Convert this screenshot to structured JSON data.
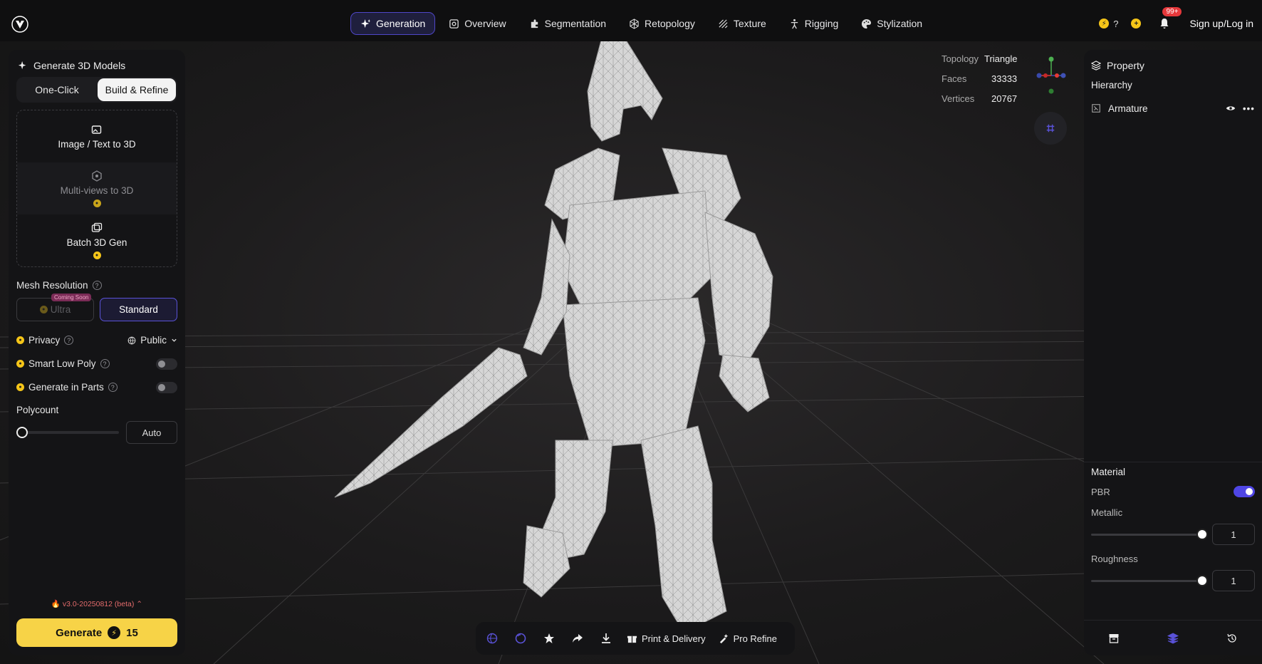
{
  "nav": {
    "items": [
      {
        "label": "Generation",
        "icon": "sparkle-icon",
        "active": true
      },
      {
        "label": "Overview",
        "icon": "overview-icon"
      },
      {
        "label": "Segmentation",
        "icon": "puzzle-icon"
      },
      {
        "label": "Retopology",
        "icon": "mesh-icon"
      },
      {
        "label": "Texture",
        "icon": "texture-icon"
      },
      {
        "label": "Rigging",
        "icon": "figure-icon"
      },
      {
        "label": "Stylization",
        "icon": "palette-icon"
      }
    ]
  },
  "top_right": {
    "credits_label": "?",
    "notifications_badge": "99+",
    "signin_label": "Sign up/Log in"
  },
  "left_panel": {
    "title": "Generate 3D Models",
    "tabs": [
      "One-Click",
      "Build & Refine"
    ],
    "modes": [
      {
        "label": "Image / Text to 3D"
      },
      {
        "label": "Multi-views to 3D"
      },
      {
        "label": "Batch 3D Gen"
      }
    ],
    "mesh_resolution_label": "Mesh Resolution",
    "resolution_options": [
      "Ultra",
      "Standard"
    ],
    "coming_soon_label": "Coming Soon",
    "privacy_label": "Privacy",
    "privacy_value": "Public",
    "smart_low_poly_label": "Smart Low Poly",
    "generate_in_parts_label": "Generate in Parts",
    "polycount_label": "Polycount",
    "polycount_value": "Auto",
    "version_label": "v3.0-20250812 (beta)",
    "generate_label": "Generate",
    "generate_cost": "15"
  },
  "stats": {
    "topology_label": "Topology",
    "topology_value": "Triangle",
    "faces_label": "Faces",
    "faces_value": "33333",
    "vertices_label": "Vertices",
    "vertices_value": "20767"
  },
  "right_panel": {
    "title": "Property",
    "hierarchy_label": "Hierarchy",
    "tree_item": "Armature",
    "material_label": "Material",
    "pbr_label": "PBR",
    "metallic_label": "Metallic",
    "metallic_value": "1",
    "roughness_label": "Roughness",
    "roughness_value": "1"
  },
  "bottom_bar": {
    "print_label": "Print & Delivery",
    "pro_refine_label": "Pro Refine"
  },
  "colors": {
    "accent": "#4f46e5",
    "generate_yellow": "#f7d347",
    "coin_yellow": "#f5c518"
  }
}
